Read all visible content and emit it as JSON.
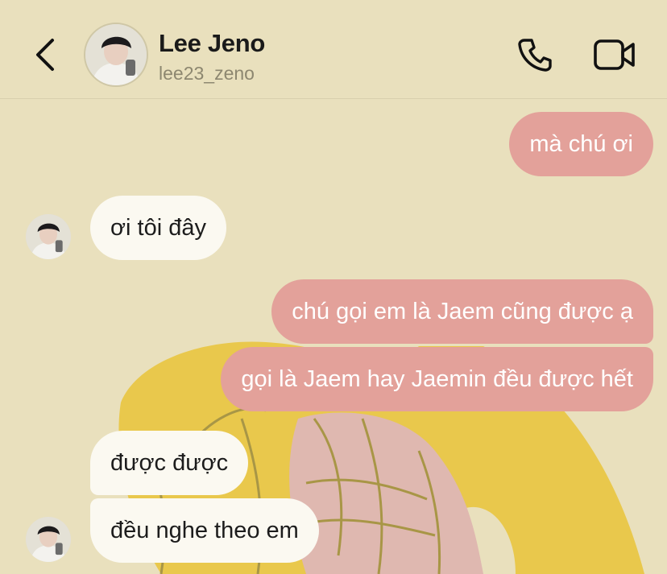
{
  "header": {
    "contact_name": "Lee Jeno",
    "username": "lee23_zeno",
    "back_icon": "chevron-left-icon",
    "call_icon": "phone-icon",
    "video_icon": "video-camera-icon"
  },
  "messages": [
    {
      "direction": "outgoing",
      "text": "mà chú ơi"
    },
    {
      "direction": "incoming",
      "text": "ơi tôi đây"
    },
    {
      "direction": "outgoing",
      "text": "chú gọi em là Jaem cũng được ạ"
    },
    {
      "direction": "outgoing",
      "text": "gọi là Jaem hay Jaemin đều được hết"
    },
    {
      "direction": "incoming",
      "text": "được được"
    },
    {
      "direction": "incoming",
      "text": "đều nghe theo em"
    }
  ],
  "colors": {
    "background": "#e9e0bd",
    "outgoing_bubble": "#e3a19a",
    "incoming_bubble": "#fbf9f1",
    "wallpaper_yellow": "#e9c84c",
    "wallpaper_pink": "#dfb8b0"
  }
}
